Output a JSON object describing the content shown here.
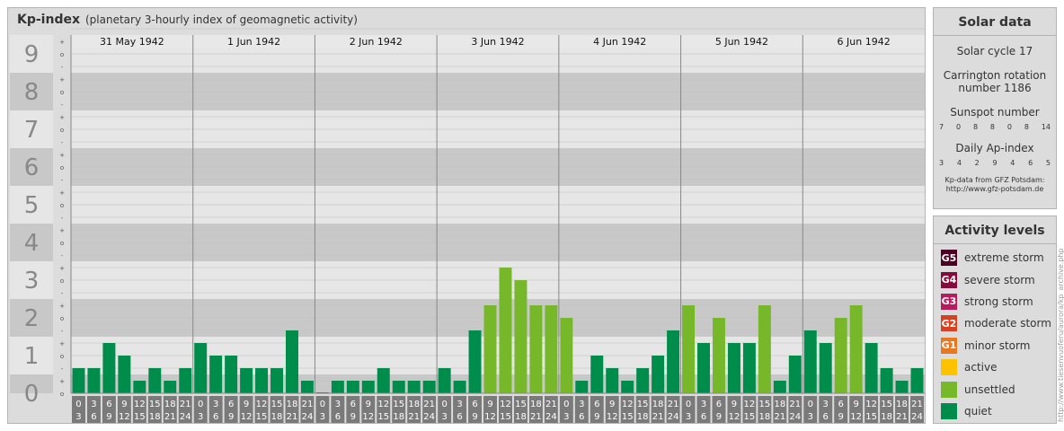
{
  "title": "Kp-index",
  "subtitle": "(planetary 3-hourly index of geomagnetic activity)",
  "chart_data": {
    "type": "bar",
    "title": "Kp-index",
    "subtitle": "(planetary 3-hourly index of geomagnetic activity)",
    "ylim": [
      0,
      9
    ],
    "y_ticks": [
      "0",
      "1",
      "2",
      "3",
      "4",
      "5",
      "6",
      "7",
      "8",
      "9"
    ],
    "y_subticks": [
      "-",
      "o",
      "+"
    ],
    "days": [
      "31 May 1942",
      "1 Jun 1942",
      "2 Jun 1942",
      "3 Jun 1942",
      "4 Jun 1942",
      "5 Jun 1942",
      "6 Jun 1942"
    ],
    "intervals": [
      [
        "0",
        "3"
      ],
      [
        "3",
        "6"
      ],
      [
        "6",
        "9"
      ],
      [
        "9",
        "12"
      ],
      [
        "12",
        "15"
      ],
      [
        "15",
        "18"
      ],
      [
        "18",
        "21"
      ],
      [
        "21",
        "24"
      ]
    ],
    "series": [
      {
        "values": [
          0.667,
          0.667,
          1.333,
          1.0,
          0.333,
          0.667,
          0.333,
          0.667
        ]
      },
      {
        "values": [
          1.333,
          1.0,
          1.0,
          0.667,
          0.667,
          0.667,
          1.667,
          0.333
        ]
      },
      {
        "values": [
          0.0,
          0.333,
          0.333,
          0.333,
          0.667,
          0.333,
          0.333,
          0.333
        ]
      },
      {
        "values": [
          0.667,
          0.333,
          1.667,
          2.333,
          3.333,
          3.0,
          2.333,
          2.333
        ]
      },
      {
        "values": [
          2.0,
          0.333,
          1.0,
          0.667,
          0.333,
          0.667,
          1.0,
          1.667
        ]
      },
      {
        "values": [
          2.333,
          1.333,
          2.0,
          1.333,
          1.333,
          2.333,
          0.333,
          1.0
        ]
      },
      {
        "values": [
          1.667,
          1.333,
          2.0,
          2.333,
          1.333,
          0.667,
          0.333,
          0.667
        ]
      }
    ],
    "colors": {
      "quiet": "#008c4b",
      "unsettled": "#76b82a",
      "active": "#fcc200",
      "minor": "#e87722",
      "moderate": "#d64121",
      "strong": "#b71b5a",
      "severe": "#860a3c",
      "extreme": "#4b0024"
    }
  },
  "solar": {
    "title": "Solar data",
    "cycle": "Solar cycle 17",
    "carrington_line1": "Carrington rotation",
    "carrington_line2": "number 1186",
    "sunspot_title": "Sunspot number",
    "sunspot_values": [
      "7",
      "0",
      "8",
      "8",
      "0",
      "8",
      "14"
    ],
    "ap_title": "Daily Ap-index",
    "ap_values": [
      "3",
      "4",
      "2",
      "9",
      "4",
      "6",
      "5"
    ],
    "credit_line1": "Kp-data from GFZ Potsdam:",
    "credit_line2": "http://www.gfz-potsdam.de"
  },
  "activity": {
    "title": "Activity levels",
    "levels": [
      {
        "code": "G5",
        "label": "extreme storm",
        "color": "#4b0024"
      },
      {
        "code": "G4",
        "label": "severe storm",
        "color": "#860a3c"
      },
      {
        "code": "G3",
        "label": "strong storm",
        "color": "#b71b5a"
      },
      {
        "code": "G2",
        "label": "moderate storm",
        "color": "#d64121"
      },
      {
        "code": "G1",
        "label": "minor storm",
        "color": "#e87722"
      },
      {
        "code": "",
        "label": "active",
        "color": "#fcc200"
      },
      {
        "code": "",
        "label": "unsettled",
        "color": "#76b82a"
      },
      {
        "code": "",
        "label": "quiet",
        "color": "#008c4b"
      }
    ]
  },
  "watermark": "http://www.tiesenvuoferu/aurora/kp_archive.php"
}
